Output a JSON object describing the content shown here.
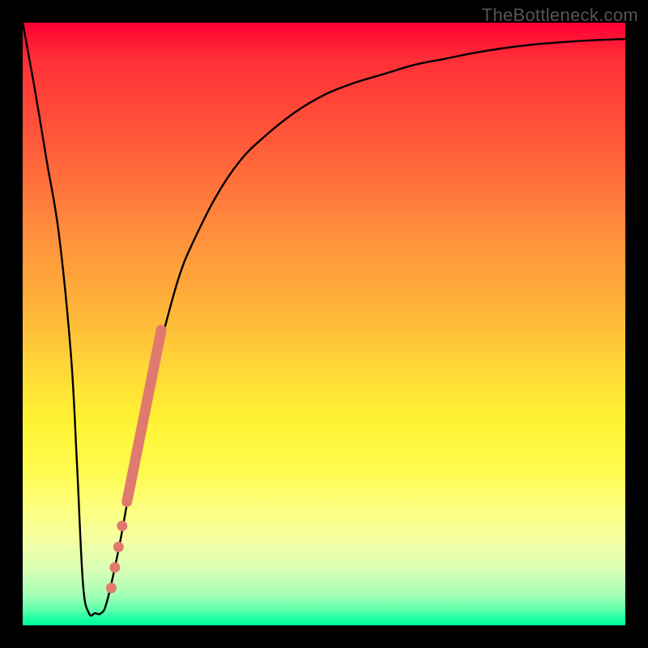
{
  "watermark": "TheBottleneck.com",
  "colors": {
    "curve": "#000000",
    "highlight": "#e07a6f"
  },
  "chart_data": {
    "type": "line",
    "title": "",
    "xlabel": "",
    "ylabel": "",
    "xlim": [
      0,
      100
    ],
    "ylim": [
      0,
      100
    ],
    "grid": false,
    "legend": false,
    "series": [
      {
        "name": "bottleneck-curve",
        "x": [
          0,
          2,
          4,
          6,
          8,
          9,
          10,
          11,
          12,
          13,
          14,
          16,
          18,
          20,
          22,
          24,
          26,
          28,
          32,
          36,
          40,
          45,
          50,
          55,
          60,
          65,
          70,
          75,
          80,
          85,
          90,
          95,
          100
        ],
        "y": [
          100,
          89,
          77,
          65,
          45,
          27,
          7,
          2,
          2,
          2,
          4,
          13,
          24,
          34,
          43,
          51,
          58,
          63,
          71,
          77,
          81,
          85,
          88,
          90,
          91.5,
          93,
          94,
          95,
          95.8,
          96.4,
          96.8,
          97.1,
          97.3
        ]
      },
      {
        "name": "highlight-segment",
        "x": [
          17.3,
          23.0
        ],
        "y": [
          20.5,
          49.0
        ]
      }
    ],
    "highlight_dots": [
      {
        "x": 16.5,
        "y": 16.5,
        "r": 6.5
      },
      {
        "x": 15.9,
        "y": 13.0,
        "r": 6.5
      },
      {
        "x": 15.3,
        "y": 9.6,
        "r": 6.5
      },
      {
        "x": 14.7,
        "y": 6.2,
        "r": 6.5
      }
    ]
  }
}
